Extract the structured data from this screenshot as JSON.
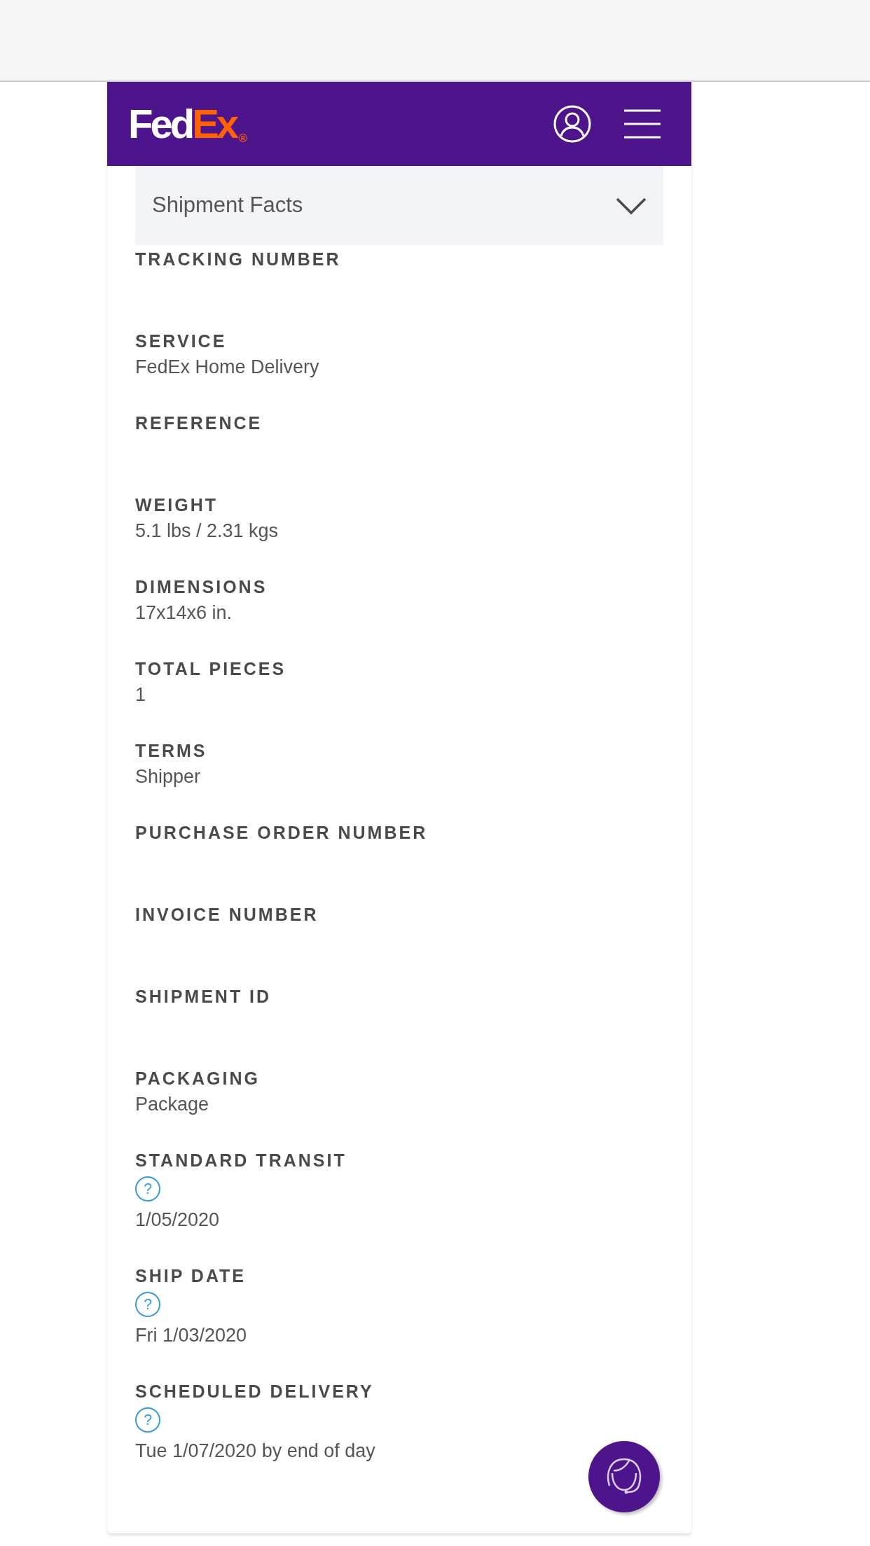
{
  "header": {
    "logo": {
      "part1": "Fed",
      "part2": "Ex",
      "mark": "®"
    }
  },
  "section": {
    "title": "Shipment Facts",
    "expanded": true
  },
  "fields": [
    {
      "label": "TRACKING NUMBER"
    },
    {
      "label": "SERVICE",
      "value": "FedEx Home Delivery"
    },
    {
      "label": "REFERENCE"
    },
    {
      "label": "WEIGHT",
      "value": "5.1 lbs / 2.31 kgs"
    },
    {
      "label": "DIMENSIONS",
      "value": "17x14x6 in."
    },
    {
      "label": "TOTAL PIECES",
      "value": "1"
    },
    {
      "label": "TERMS",
      "value": "Shipper"
    },
    {
      "label": "PURCHASE ORDER NUMBER"
    },
    {
      "label": "INVOICE NUMBER"
    },
    {
      "label": "SHIPMENT ID"
    },
    {
      "label": "PACKAGING",
      "value": "Package"
    },
    {
      "label": "STANDARD TRANSIT",
      "help": "?",
      "value": "1/05/2020"
    },
    {
      "label": "SHIP DATE",
      "help": "?",
      "value": "Fri 1/03/2020"
    },
    {
      "label": "SCHEDULED DELIVERY",
      "help": "?",
      "value": "Tue 1/07/2020 by end of day"
    }
  ]
}
